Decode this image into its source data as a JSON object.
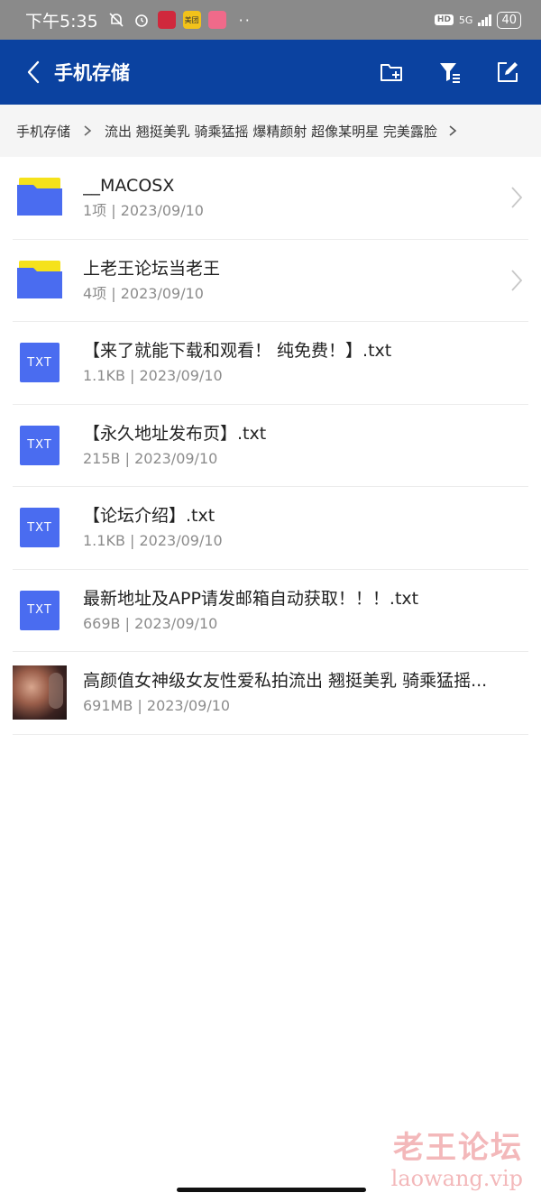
{
  "status_bar": {
    "time": "下午5:35",
    "app_icons": [
      {
        "name": "bell-muted-icon",
        "label": ""
      },
      {
        "name": "alarm-icon",
        "label": ""
      },
      {
        "name": "red-app-icon",
        "label": "",
        "color": "#d0283c"
      },
      {
        "name": "yellow-app-icon",
        "label": "美团",
        "color": "#f2c21a"
      },
      {
        "name": "pink-app-icon",
        "label": "",
        "color": "#f06a8a"
      }
    ],
    "dots": "··",
    "hd_label": "HD",
    "network_label": "5G",
    "battery": "40"
  },
  "header": {
    "title": "手机存储",
    "background": "#0b42a0",
    "actions": [
      {
        "name": "new-folder-icon"
      },
      {
        "name": "filter-icon"
      },
      {
        "name": "edit-icon"
      }
    ]
  },
  "breadcrumb": {
    "root": "手机存储",
    "current": "流出 翘挺美乳 骑乘猛摇 爆精颜射 超像某明星 完美露脸"
  },
  "files": [
    {
      "type": "folder",
      "name": "__MACOSX",
      "meta": "1项 | 2023/09/10"
    },
    {
      "type": "folder",
      "name": "上老王论坛当老王",
      "meta": "4项 | 2023/09/10"
    },
    {
      "type": "txt",
      "icon_label": "TXT",
      "name": "【来了就能下载和观看！ 纯免费！】.txt",
      "meta": "1.1KB | 2023/09/10"
    },
    {
      "type": "txt",
      "icon_label": "TXT",
      "name": "【永久地址发布页】.txt",
      "meta": "215B | 2023/09/10"
    },
    {
      "type": "txt",
      "icon_label": "TXT",
      "name": "【论坛介绍】.txt",
      "meta": "1.1KB | 2023/09/10"
    },
    {
      "type": "txt",
      "icon_label": "TXT",
      "name": "最新地址及APP请发邮箱自动获取！！！.txt",
      "meta": "669B | 2023/09/10"
    },
    {
      "type": "video",
      "name": "高颜值女神级女友性爱私拍流出 翘挺美乳 骑乘猛摇...",
      "meta": "691MB | 2023/09/10"
    }
  ],
  "watermark": {
    "cn": "老王论坛",
    "en": "laowang.vip"
  }
}
